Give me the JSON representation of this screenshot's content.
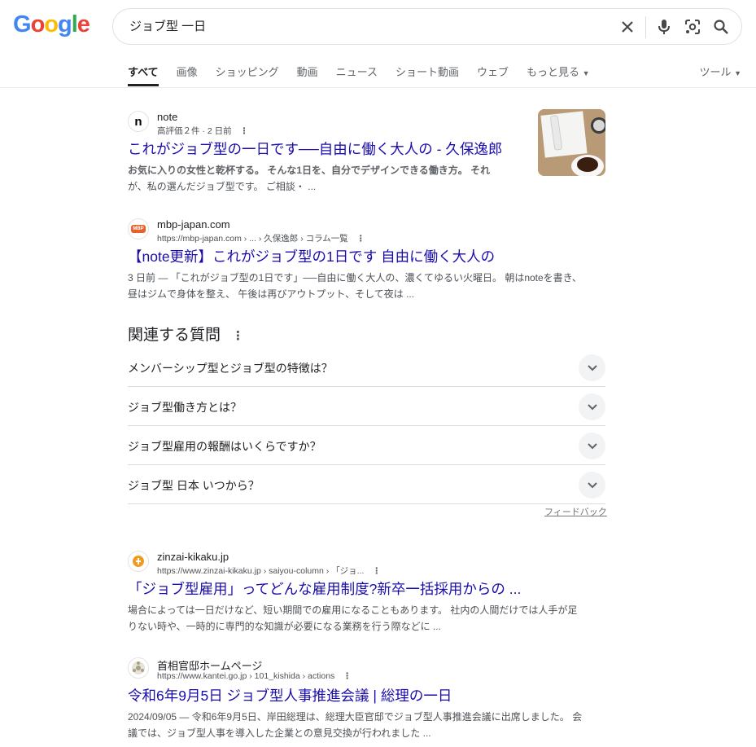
{
  "header": {
    "logo_letters": [
      "G",
      "o",
      "o",
      "g",
      "l",
      "e"
    ],
    "logo_colors": [
      "#4285F4",
      "#EA4335",
      "#FBBC05",
      "#4285F4",
      "#34A853",
      "#EA4335"
    ],
    "query": "ジョブ型 一日",
    "icons": [
      "close-icon",
      "microphone-icon",
      "lens-icon",
      "search-icon"
    ]
  },
  "tabs": {
    "items": [
      "すべて",
      "画像",
      "ショッピング",
      "動画",
      "ニュース",
      "ショート動画",
      "ウェブ",
      "もっと見る"
    ],
    "tools": "ツール"
  },
  "results": [
    {
      "site_name": "note",
      "site_meta": "高評価２件 · 2 日前",
      "favicon_text": "n",
      "title": "これがジョブ型の一日です──自由に働く大人の - 久保逸郎",
      "snippet_line1": "お気に入りの女性と乾杯する。 そんな1日を、自分でデザインできる働き方。 それ",
      "snippet_line2": "が、私の選んだジョブ型です。 ご相談・ ..."
    },
    {
      "site_name": "mbp-japan.com",
      "site_meta": "https://mbp-japan.com › ... › 久保逸郎 › コラム一覧",
      "favicon_text": "MBP",
      "title": "【note更新】これがジョブ型の1日です 自由に働く大人の",
      "snippet_line1": "3 日前 — 「これがジョブ型の1日です」──自由に働く大人の、濃くてゆるい火曜日。 朝はnoteを書き、",
      "snippet_line2": "昼はジムで身体を整え、 午後は再びアウトプット、そして夜は ..."
    },
    {
      "site_name": "zinzai-kikaku.jp",
      "site_meta": "https://www.zinzai-kikaku.jp › saiyou-column › 「ジョ...",
      "favicon_text": "",
      "title": "「ジョブ型雇用」ってどんな雇用制度?新卒一括採用からの ...",
      "snippet_line1": "場合によっては一日だけなど、短い期間での雇用になることもあります。 社内の人間だけでは人手が足",
      "snippet_line2": "りない時や、一時的に専門的な知識が必要になる業務を行う際などに ..."
    },
    {
      "site_name": "首相官邸ホームページ",
      "site_meta": "https://www.kantei.go.jp › 101_kishida › actions",
      "favicon_text": "",
      "title": "令和6年9月5日 ジョブ型人事推進会議 | 総理の一日",
      "snippet_line1": "2024/09/05 — 令和6年9月5日、岸田総理は、総理大臣官邸でジョブ型人事推進会議に出席しました。 会",
      "snippet_line2": "議では、ジョブ型人事を導入した企業との意見交換が行われました ..."
    }
  ],
  "paa": {
    "heading": "関連する質問",
    "questions": [
      "メンバーシップ型とジョブ型の特徴は？",
      "ジョブ型働き方とは？",
      "ジョブ型雇用の報酬はいくらですか？",
      "ジョブ型 日本 いつから？"
    ],
    "feedback": "フィードバック"
  }
}
